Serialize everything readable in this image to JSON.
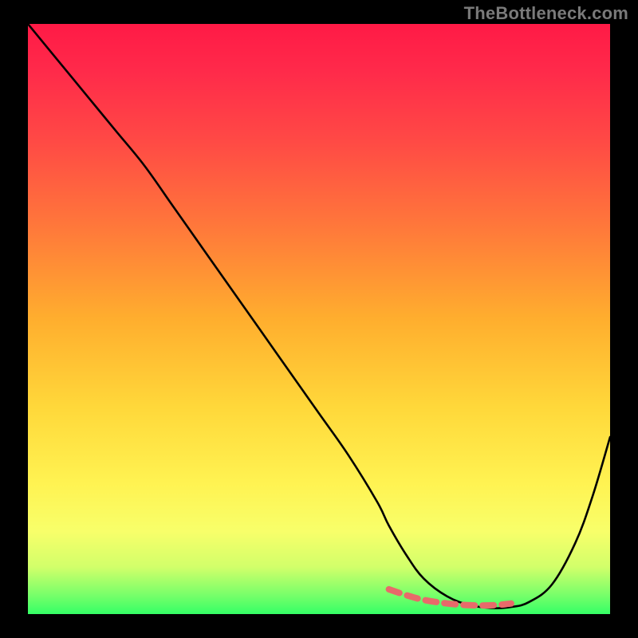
{
  "watermark": "TheBottleneck.com",
  "colors": {
    "frame": "#000000",
    "curve_black": "#000000",
    "highlight_stroke": "#e86a6a",
    "gradient_stops": [
      {
        "offset": 0.0,
        "color": "#ff1a46"
      },
      {
        "offset": 0.08,
        "color": "#ff2a4a"
      },
      {
        "offset": 0.2,
        "color": "#ff4a45"
      },
      {
        "offset": 0.35,
        "color": "#ff7a3a"
      },
      {
        "offset": 0.5,
        "color": "#ffae2e"
      },
      {
        "offset": 0.65,
        "color": "#ffd83a"
      },
      {
        "offset": 0.78,
        "color": "#fff352"
      },
      {
        "offset": 0.86,
        "color": "#f8ff6a"
      },
      {
        "offset": 0.92,
        "color": "#d2ff6a"
      },
      {
        "offset": 0.965,
        "color": "#7dff6a"
      },
      {
        "offset": 1.0,
        "color": "#35ff66"
      }
    ]
  },
  "chart_data": {
    "type": "line",
    "title": "",
    "xlabel": "",
    "ylabel": "",
    "xlim": [
      0,
      100
    ],
    "ylim": [
      0,
      100
    ],
    "grid": false,
    "legend": false,
    "series": [
      {
        "name": "bottleneck-curve",
        "x": [
          0,
          5,
          10,
          15,
          20,
          25,
          30,
          35,
          40,
          45,
          50,
          55,
          60,
          62,
          65,
          68,
          72,
          76,
          80,
          83,
          86,
          90,
          94,
          97,
          100
        ],
        "y": [
          100,
          94,
          88,
          82,
          76,
          69,
          62,
          55,
          48,
          41,
          34,
          27,
          19,
          15,
          10,
          6,
          3,
          1.5,
          1,
          1.2,
          2,
          5,
          12,
          20,
          30
        ]
      },
      {
        "name": "optimal-range-highlight",
        "x": [
          62,
          65,
          68,
          72,
          76,
          80,
          83
        ],
        "y": [
          4.2,
          3.2,
          2.4,
          1.8,
          1.5,
          1.5,
          1.8
        ]
      }
    ],
    "annotations": []
  }
}
